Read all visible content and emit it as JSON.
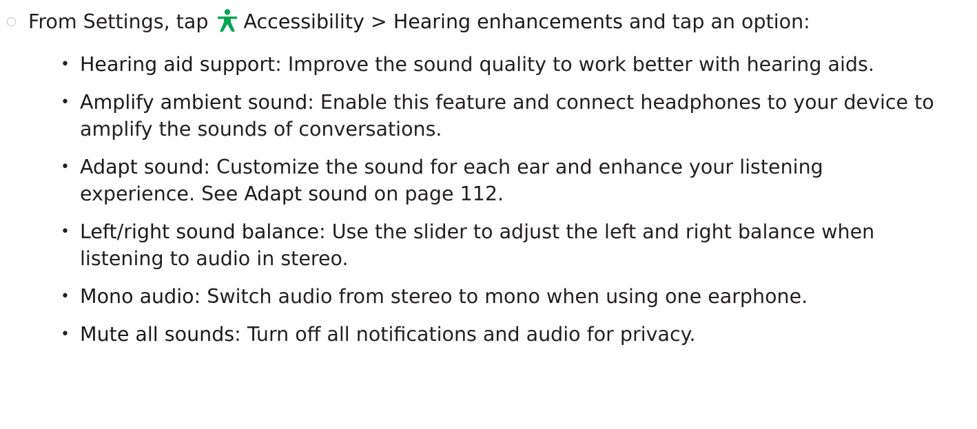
{
  "step": {
    "intro": "From Settings, tap",
    "icon": "accessibility-icon",
    "icon_color": "#00a651",
    "menu_item": "Accessibility",
    "separator": ">",
    "submenu_item": "Hearing enhancements",
    "outro": "and tap an option:"
  },
  "options": [
    {
      "title": "Hearing aid support",
      "description": "Improve the sound quality to work better with hearing aids."
    },
    {
      "title": "Amplify ambient sound",
      "description": "Enable this feature and connect headphones to your device to amplify the sounds of conversations."
    },
    {
      "title": "Adapt sound",
      "description": "Customize the sound for each ear and enhance your listening experience. See",
      "link_text": "Adapt sound",
      "suffix": "on page 112."
    },
    {
      "title": "Left/right sound balance",
      "description": "Use the slider to adjust the left and right balance when listening to audio in stereo."
    },
    {
      "title": "Mono audio",
      "description": "Switch audio from stereo to mono when using one earphone."
    },
    {
      "title": "Mute all sounds",
      "description": "Turn off all notifications and audio for privacy."
    }
  ]
}
